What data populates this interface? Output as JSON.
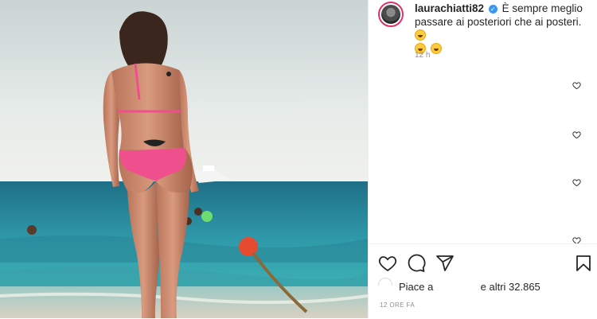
{
  "post": {
    "username": "laurachiatti82",
    "caption": "È sempre meglio passare ai posteriori che ai posteri.",
    "caption_time": "12 h",
    "likes_prefix": "Piace a",
    "likes_suffix": "e altri 32.865",
    "post_time": "12 ORE FA"
  },
  "icons": {
    "verified": "verified-badge-icon",
    "emoji": "laughing-emoji-icon",
    "like": "heart-icon",
    "comment": "comment-icon",
    "share": "paper-plane-icon",
    "save": "bookmark-icon",
    "comment_like": "small-heart-icon"
  },
  "colors": {
    "verified": "#3897f0",
    "text": "#262626",
    "muted": "#8e8e8e",
    "story_ring": "#e1306c"
  }
}
